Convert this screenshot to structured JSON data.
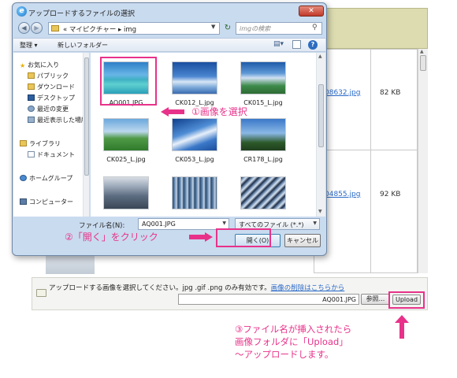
{
  "dialog": {
    "title": "アップロードするファイルの選択",
    "address": {
      "prefix": "«",
      "path": [
        "マイピクチャー",
        "img"
      ],
      "separator": "▸"
    },
    "search_placeholder": "imgの検索",
    "toolbar": {
      "organize": "整理 ▾",
      "new_folder": "新しいフォルダー"
    },
    "nav_items": [
      {
        "label": "お気に入り",
        "icon": "star-icon"
      },
      {
        "label": "パブリック",
        "icon": "folder-icon"
      },
      {
        "label": "ダウンロード",
        "icon": "folder-icon"
      },
      {
        "label": "デスクトップ",
        "icon": "desktop-icon"
      },
      {
        "label": "最近の変更",
        "icon": "recent-icon"
      },
      {
        "label": "最近表示した場所",
        "icon": "recent-places-icon"
      },
      {
        "label": "ライブラリ",
        "icon": "library-icon"
      },
      {
        "label": "ドキュメント",
        "icon": "document-icon"
      },
      {
        "label": "ホームグループ",
        "icon": "homegroup-icon"
      },
      {
        "label": "コンピューター",
        "icon": "computer-icon"
      }
    ],
    "files": [
      {
        "name": "AQ001.JPG"
      },
      {
        "name": "CK012_L.jpg"
      },
      {
        "name": "CK015_L.jpg"
      },
      {
        "name": "CK025_L.jpg"
      },
      {
        "name": "CK053_L.jpg"
      },
      {
        "name": "CR178_L.jpg"
      },
      {
        "name": ""
      },
      {
        "name": ""
      },
      {
        "name": ""
      }
    ],
    "filename_label": "ファイル名(N):",
    "filename_value": "AQ001.JPG",
    "filetype_value": "すべてのファイル (*.*)",
    "open_label": "開く(O)",
    "cancel_label": "キャンセル"
  },
  "background": {
    "rows": [
      {
        "link": "08632.jpg",
        "size": "82 KB"
      },
      {
        "link": "04855.jpg",
        "size": "92 KB"
      }
    ],
    "upload_text": "アップロードする画像を選択してください。jpg .gif .png のみ有効です。",
    "upload_link": "画像の削除はこちらから",
    "file_field_value": "AQ001.JPG",
    "browse_label": "参照...",
    "upload_label": "Upload"
  },
  "annotations": {
    "step1": "①画像を選択",
    "step2": "②「開く」をクリック",
    "step3": [
      "③ファイル名が挿入されたら",
      "画像フォルダに「Upload」",
      "～アップロードします。"
    ]
  },
  "colors": {
    "annotation": "#e8328a",
    "link": "#2a6ac8"
  }
}
